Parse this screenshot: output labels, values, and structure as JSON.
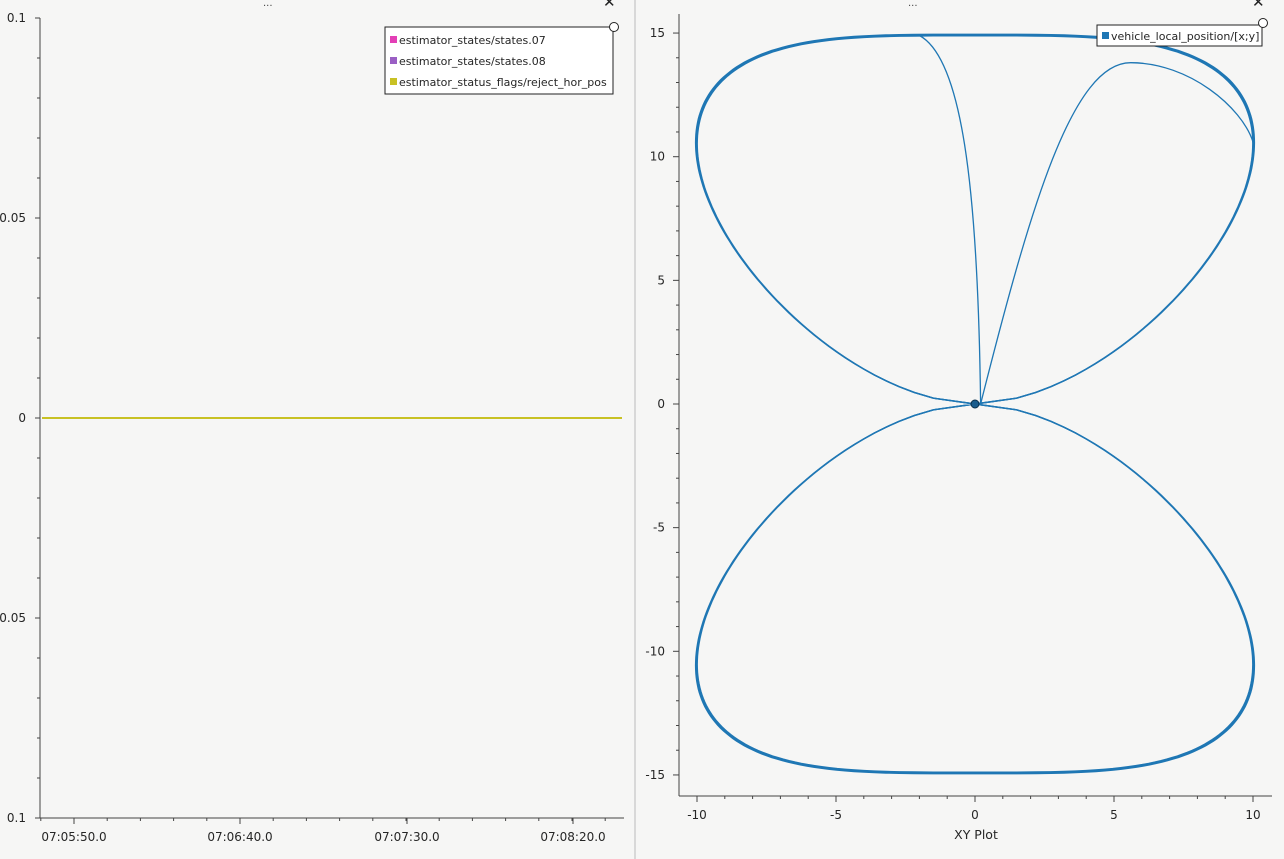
{
  "panels": {
    "left": {
      "drag_handle": "...",
      "close_glyph": "✕",
      "chart_data": {
        "type": "line",
        "title": "",
        "xlabel": "",
        "ylabel": "",
        "x_ticks": [
          "07:05:50.0",
          "07:06:40.0",
          "07:07:30.0",
          "07:08:20.0"
        ],
        "y_ticks": [
          "0.1",
          "0.05",
          "0",
          "0.05",
          "0.1"
        ],
        "ylim": [
          -0.1,
          0.1
        ],
        "grid": false,
        "legend_position": "top-right",
        "series": [
          {
            "name": "estimator_states/states.07",
            "color": "#e33fb6",
            "values": [
              0,
              0
            ]
          },
          {
            "name": "estimator_states/states.08",
            "color": "#9a5fc4",
            "values": [
              0,
              0
            ]
          },
          {
            "name": "estimator_status_flags/reject_hor_pos",
            "color": "#c8c124",
            "values": [
              0,
              0
            ]
          }
        ]
      }
    },
    "right": {
      "drag_handle": "...",
      "close_glyph": "✕",
      "chart_data": {
        "type": "scatter",
        "title": "",
        "xlabel": "XY Plot",
        "ylabel": "",
        "x_ticks": [
          "-10",
          "-5",
          "0",
          "5",
          "10"
        ],
        "y_ticks": [
          "15",
          "10",
          "5",
          "0",
          "-5",
          "-10",
          "-15"
        ],
        "xlim": [
          -10.8,
          10.8
        ],
        "ylim": [
          -15.6,
          15.6
        ],
        "grid": false,
        "legend_position": "top-right",
        "series": [
          {
            "name": "vehicle_local_position/[x;y]",
            "color": "#1f77b4",
            "path_description": "figure-eight trajectory of amplitude 10 in x and 15 in y, plus two takeoff/landing excursions",
            "x": [
              0,
              4,
              8,
              10,
              8,
              4,
              0,
              -4,
              -8,
              -10,
              -8,
              -4,
              0,
              4,
              8,
              10,
              8,
              4,
              0,
              -4,
              -8,
              -10,
              -8,
              -4,
              0,
              -2,
              0.2,
              5.6,
              10
            ],
            "y": [
              0,
              5.6,
              10.4,
              12,
              15,
              15,
              15,
              15,
              14,
              11,
              7,
              3.5,
              0,
              -3.5,
              -7,
              -11,
              -14,
              -15,
              -15,
              -15,
              -14,
              -11,
              -7,
              -3.5,
              0,
              14.9,
              0,
              13.8,
              10
            ]
          }
        ],
        "origin_marker": {
          "x": 0,
          "y": 0
        }
      }
    }
  }
}
